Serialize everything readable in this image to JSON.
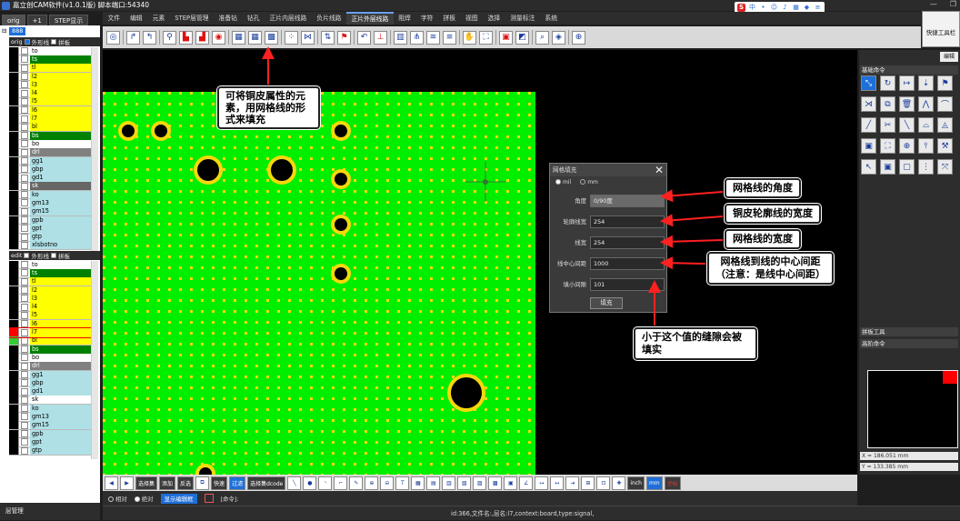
{
  "app": {
    "title": "嘉立创CAM软件(v1.0.1版) 脚本端口:54340",
    "window_controls": [
      "—",
      "❐"
    ]
  },
  "left_tabs": [
    "orig",
    "+1",
    "STEP显示"
  ],
  "menu": [
    "文件",
    "编辑",
    "元素",
    "STEP层管理",
    "准备钻",
    "钻孔",
    "正片内层线路",
    "负片线路",
    "正片外层线路",
    "阻焊",
    "字符",
    "拼板",
    "视图",
    "选择",
    "测量标注",
    "系统"
  ],
  "quick_panel_label": "快捷工具栏",
  "tree": {
    "root": "888",
    "orig_label": "orig",
    "outline_label": "外形线",
    "panel_label": "拼板",
    "edit_label": "edit"
  },
  "orig_layers": [
    {
      "name": "to",
      "sw": "#000000",
      "bg": "#ffffff"
    },
    {
      "name": "ts",
      "sw": "#000000",
      "bg": "#008000"
    },
    {
      "name": "tl",
      "sw": "#000000",
      "bg": "#ffff00"
    },
    {
      "name": "l2",
      "sw": "#000000",
      "bg": "#ffff00"
    },
    {
      "name": "l3",
      "sw": "#000000",
      "bg": "#ffff00"
    },
    {
      "name": "l4",
      "sw": "#000000",
      "bg": "#ffff00"
    },
    {
      "name": "l5",
      "sw": "#000000",
      "bg": "#ffff00"
    },
    {
      "name": "l6",
      "sw": "#000000",
      "bg": "#ffff00"
    },
    {
      "name": "l7",
      "sw": "#000000",
      "bg": "#ffff00"
    },
    {
      "name": "bl",
      "sw": "#000000",
      "bg": "#ffff00"
    },
    {
      "name": "bs",
      "sw": "#000000",
      "bg": "#008000"
    },
    {
      "name": "bo",
      "sw": "#000000",
      "bg": "#ffffff"
    },
    {
      "name": "drl",
      "sw": "#000000",
      "bg": "#808080"
    },
    {
      "name": "gg1",
      "sw": "#000000",
      "bg": "#aee0e6"
    },
    {
      "name": "gbp",
      "sw": "#000000",
      "bg": "#aee0e6"
    },
    {
      "name": "gd1",
      "sw": "#000000",
      "bg": "#aee0e6"
    },
    {
      "name": "sk",
      "sw": "#000000",
      "bg": "#666666"
    },
    {
      "name": "ko",
      "sw": "#000000",
      "bg": "#aee0e6"
    },
    {
      "name": "gm13",
      "sw": "#000000",
      "bg": "#aee0e6"
    },
    {
      "name": "gm15",
      "sw": "#000000",
      "bg": "#aee0e6"
    },
    {
      "name": "gpb",
      "sw": "#000000",
      "bg": "#aee0e6"
    },
    {
      "name": "gpt",
      "sw": "#000000",
      "bg": "#aee0e6"
    },
    {
      "name": "gtp",
      "sw": "#000000",
      "bg": "#aee0e6"
    },
    {
      "name": "xlsbotno",
      "sw": "#000000",
      "bg": "#aee0e6"
    }
  ],
  "edit_layers": [
    {
      "name": "to",
      "sw": "#000000",
      "bg": "#ffffff"
    },
    {
      "name": "ts",
      "sw": "#000000",
      "bg": "#008000"
    },
    {
      "name": "tl",
      "sw": "#000000",
      "bg": "#ffff00"
    },
    {
      "name": "l2",
      "sw": "#000000",
      "bg": "#ffff00"
    },
    {
      "name": "l3",
      "sw": "#000000",
      "bg": "#ffff00"
    },
    {
      "name": "l4",
      "sw": "#000000",
      "bg": "#ffff00"
    },
    {
      "name": "l5",
      "sw": "#000000",
      "bg": "#ffff00"
    },
    {
      "name": "l6",
      "sw": "#000000",
      "bg": "#ffff00"
    },
    {
      "name": "l7",
      "sw": "#ff0000",
      "bg": "#ffff00"
    },
    {
      "name": "bl",
      "sw": "#33cc33",
      "bg": "#ffff00"
    },
    {
      "name": "bs",
      "sw": "#000000",
      "bg": "#008000"
    },
    {
      "name": "bo",
      "sw": "#000000",
      "bg": "#ffffff"
    },
    {
      "name": "drl",
      "sw": "#000000",
      "bg": "#808080"
    },
    {
      "name": "gg1",
      "sw": "#000000",
      "bg": "#aee0e6"
    },
    {
      "name": "gbp",
      "sw": "#000000",
      "bg": "#aee0e6"
    },
    {
      "name": "gd1",
      "sw": "#000000",
      "bg": "#aee0e6"
    },
    {
      "name": "sk",
      "sw": "#000000",
      "bg": "#ffffff"
    },
    {
      "name": "ko",
      "sw": "#000000",
      "bg": "#aee0e6"
    },
    {
      "name": "gm13",
      "sw": "#000000",
      "bg": "#aee0e6"
    },
    {
      "name": "gm15",
      "sw": "#000000",
      "bg": "#aee0e6"
    },
    {
      "name": "gpb",
      "sw": "#000000",
      "bg": "#aee0e6"
    },
    {
      "name": "gpt",
      "sw": "#000000",
      "bg": "#aee0e6"
    },
    {
      "name": "gtp",
      "sw": "#000000",
      "bg": "#aee0e6"
    }
  ],
  "layer_manager_label": "层管理",
  "dialog": {
    "title": "网格填充",
    "unit_mil": "mil",
    "unit_mm": "mm",
    "fields": [
      {
        "label": "角度",
        "value": "0/90度"
      },
      {
        "label": "轮廓线宽",
        "value": "254"
      },
      {
        "label": "线宽",
        "value": "254"
      },
      {
        "label": "线中心间距",
        "value": "1000"
      },
      {
        "label": "填小间隙",
        "value": "101"
      }
    ],
    "fill_button": "填充",
    "close": "✕"
  },
  "callouts": {
    "top": "可将铜皮属性的元素，用网格线的形式来填充",
    "angle": "网格线的角度",
    "outline": "铜皮轮廓线的宽度",
    "width": "网格线的宽度",
    "spacing_line1": "网格线到线的中心间距",
    "spacing_line2": "（注意：是线中心间距）",
    "gap": "小于这个值的缝隙会被填实"
  },
  "right_panel": {
    "edit_label": "编辑",
    "basic_cmds": "基础命令",
    "panel_tools": "拼板工具",
    "advanced_cmds": "高阶命令",
    "coord_x": "X = 186.051 mm",
    "coord_y": "Y = 133.385 mm"
  },
  "bottom_toolbar": [
    "选择集",
    "添加",
    "反选",
    "快速",
    "过滤",
    "选择集dcode",
    "inch",
    "mm",
    "坐标"
  ],
  "bottom_bar2": {
    "relative": "相对",
    "absolute": "绝对",
    "show_cmd": "显示编辑框",
    "cmd": "[命令]:"
  },
  "status": "id:366,文件名:,层名:l7,context:board,type:signal,",
  "colors": {
    "board_yellow": "#f5d90a",
    "grid_green": "#00ee00",
    "callout_arrow": "#ff2020",
    "accent_blue": "#1e6fd8"
  }
}
